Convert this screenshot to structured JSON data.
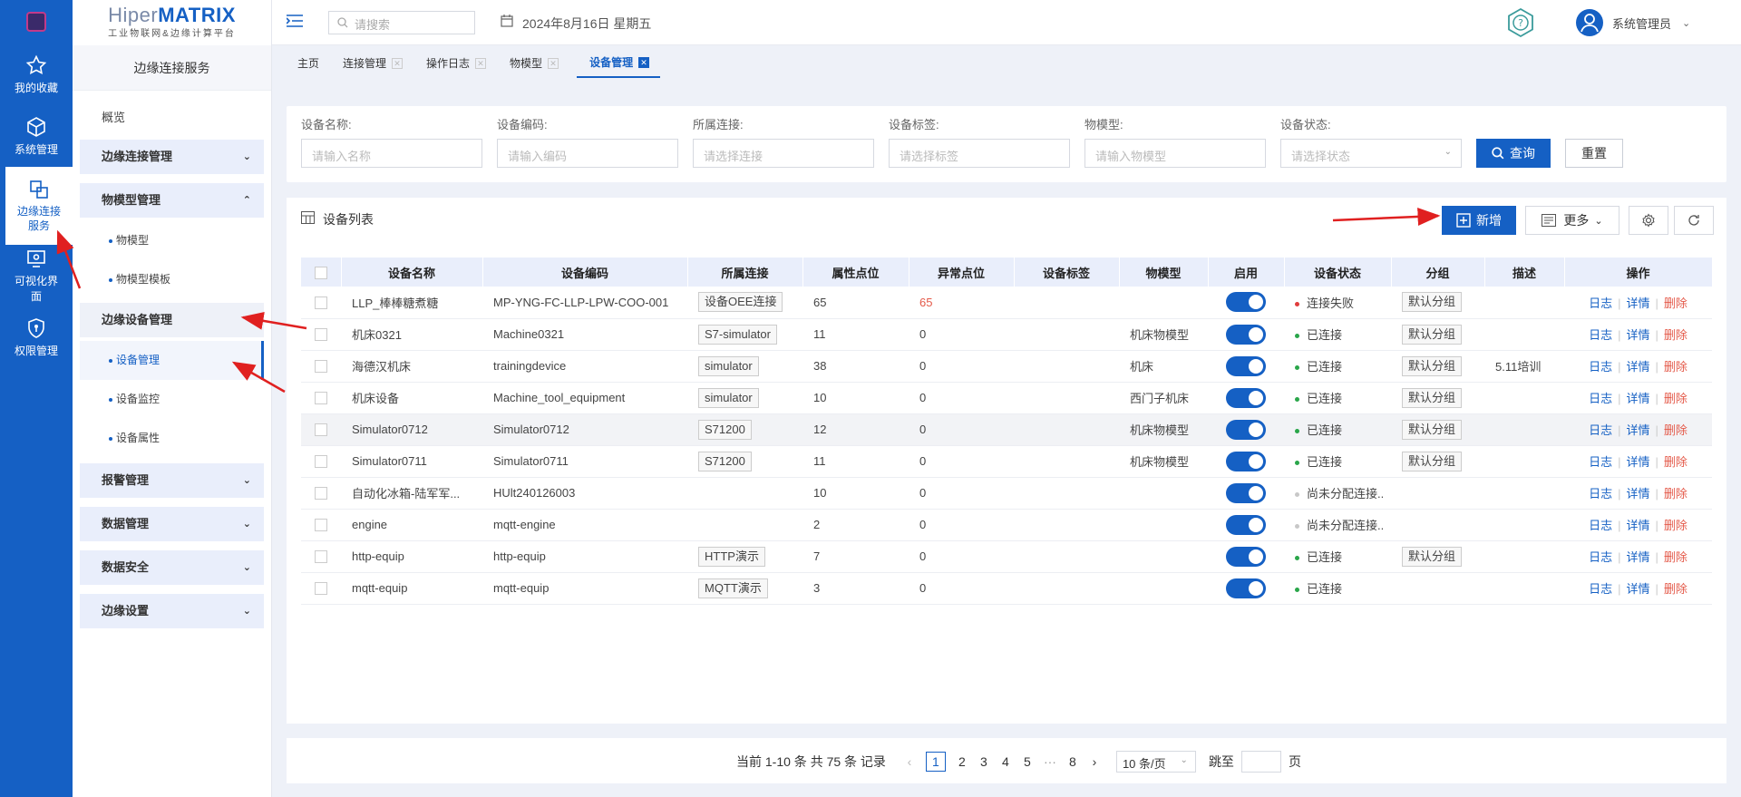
{
  "rail": {
    "items": [
      {
        "label": "我的收藏",
        "icon": "star-icon"
      },
      {
        "label": "系统管理",
        "icon": "cube-icon"
      },
      {
        "label": "边缘连接服务",
        "icon": "edge-service-icon"
      },
      {
        "label": "可视化界面",
        "icon": "eye-monitor-icon"
      },
      {
        "label": "权限管理",
        "icon": "shield-icon"
      }
    ]
  },
  "brand": {
    "name_a": "Hiper",
    "name_b": "MATRIX",
    "subtitle": "工业物联网&边缘计算平台"
  },
  "sidebar": {
    "title": "边缘连接服务",
    "overview": "概览",
    "groups": {
      "edge_conn": "边缘连接管理",
      "model": "物模型管理",
      "model_items": [
        "物模型",
        "物模型模板"
      ],
      "device": "边缘设备管理",
      "device_items": [
        "设备管理",
        "设备监控",
        "设备属性"
      ],
      "alarm": "报警管理",
      "data": "数据管理",
      "security": "数据安全",
      "settings": "边缘设置"
    }
  },
  "header": {
    "search_placeholder": "请搜索",
    "date": "2024年8月16日 星期五",
    "user": "系统管理员"
  },
  "tabs": [
    "主页",
    "连接管理",
    "操作日志",
    "物模型",
    "设备管理"
  ],
  "filter": {
    "fields": [
      {
        "label": "设备名称:",
        "placeholder": "请输入名称"
      },
      {
        "label": "设备编码:",
        "placeholder": "请输入编码"
      },
      {
        "label": "所属连接:",
        "placeholder": "请选择连接"
      },
      {
        "label": "设备标签:",
        "placeholder": "请选择标签"
      },
      {
        "label": "物模型:",
        "placeholder": "请输入物模型"
      },
      {
        "label": "设备状态:",
        "placeholder": "请选择状态"
      }
    ],
    "query": "查询",
    "reset": "重置"
  },
  "list": {
    "title": "设备列表",
    "add": "新增",
    "more": "更多",
    "columns": [
      "设备名称",
      "设备编码",
      "所属连接",
      "属性点位",
      "异常点位",
      "设备标签",
      "物模型",
      "启用",
      "设备状态",
      "分组",
      "描述",
      "操作"
    ],
    "ops": {
      "log": "日志",
      "detail": "详情",
      "delete": "删除"
    },
    "rows": [
      {
        "name": "LLP_棒棒糖煮糖",
        "code": "MP-YNG-FC-LLP-LPW-COO-001",
        "conn": "设备OEE连接",
        "attr": "65",
        "abn": "65",
        "tag": "",
        "model": "",
        "status": "连接失败",
        "status_color": "#e03c3c",
        "group": "默认分组",
        "desc": ""
      },
      {
        "name": "机床0321",
        "code": "Machine0321",
        "conn": "S7-simulator",
        "attr": "11",
        "abn": "0",
        "tag": "",
        "model": "机床物模型",
        "status": "已连接",
        "status_color": "#2aa64a",
        "group": "默认分组",
        "desc": ""
      },
      {
        "name": "海德汉机床",
        "code": "trainingdevice",
        "conn": "simulator",
        "attr": "38",
        "abn": "0",
        "tag": "",
        "model": "机床",
        "status": "已连接",
        "status_color": "#2aa64a",
        "group": "默认分组",
        "desc": "5.11培训"
      },
      {
        "name": "机床设备",
        "code": "Machine_tool_equipment",
        "conn": "simulator",
        "attr": "10",
        "abn": "0",
        "tag": "",
        "model": "西门子机床",
        "status": "已连接",
        "status_color": "#2aa64a",
        "group": "默认分组",
        "desc": ""
      },
      {
        "name": "Simulator0712",
        "code": "Simulator0712",
        "conn": "S71200",
        "attr": "12",
        "abn": "0",
        "tag": "",
        "model": "机床物模型",
        "status": "已连接",
        "status_color": "#2aa64a",
        "group": "默认分组",
        "desc": ""
      },
      {
        "name": "Simulator0711",
        "code": "Simulator0711",
        "conn": "S71200",
        "attr": "11",
        "abn": "0",
        "tag": "",
        "model": "机床物模型",
        "status": "已连接",
        "status_color": "#2aa64a",
        "group": "默认分组",
        "desc": ""
      },
      {
        "name": "自动化冰箱-陆军军...",
        "code": "HUlt240126003",
        "conn": "",
        "attr": "10",
        "abn": "0",
        "tag": "",
        "model": "",
        "status": "尚未分配连接..",
        "status_color": "#c8c8c8",
        "group": "",
        "desc": ""
      },
      {
        "name": "engine",
        "code": "mqtt-engine",
        "conn": "",
        "attr": "2",
        "abn": "0",
        "tag": "",
        "model": "",
        "status": "尚未分配连接..",
        "status_color": "#c8c8c8",
        "group": "",
        "desc": ""
      },
      {
        "name": "http-equip",
        "code": "http-equip",
        "conn": "HTTP演示",
        "attr": "7",
        "abn": "0",
        "tag": "",
        "model": "",
        "status": "已连接",
        "status_color": "#2aa64a",
        "group": "默认分组",
        "desc": ""
      },
      {
        "name": "mqtt-equip",
        "code": "mqtt-equip",
        "conn": "MQTT演示",
        "attr": "3",
        "abn": "0",
        "tag": "",
        "model": "",
        "status": "已连接",
        "status_color": "#2aa64a",
        "group": "",
        "desc": ""
      }
    ]
  },
  "pager": {
    "summary": "当前 1-10 条 共 75 条 记录",
    "pages": [
      "1",
      "2",
      "3",
      "4",
      "5",
      "···",
      "8"
    ],
    "size": "10 条/页",
    "jump_prefix": "跳至",
    "jump_suffix": "页"
  }
}
